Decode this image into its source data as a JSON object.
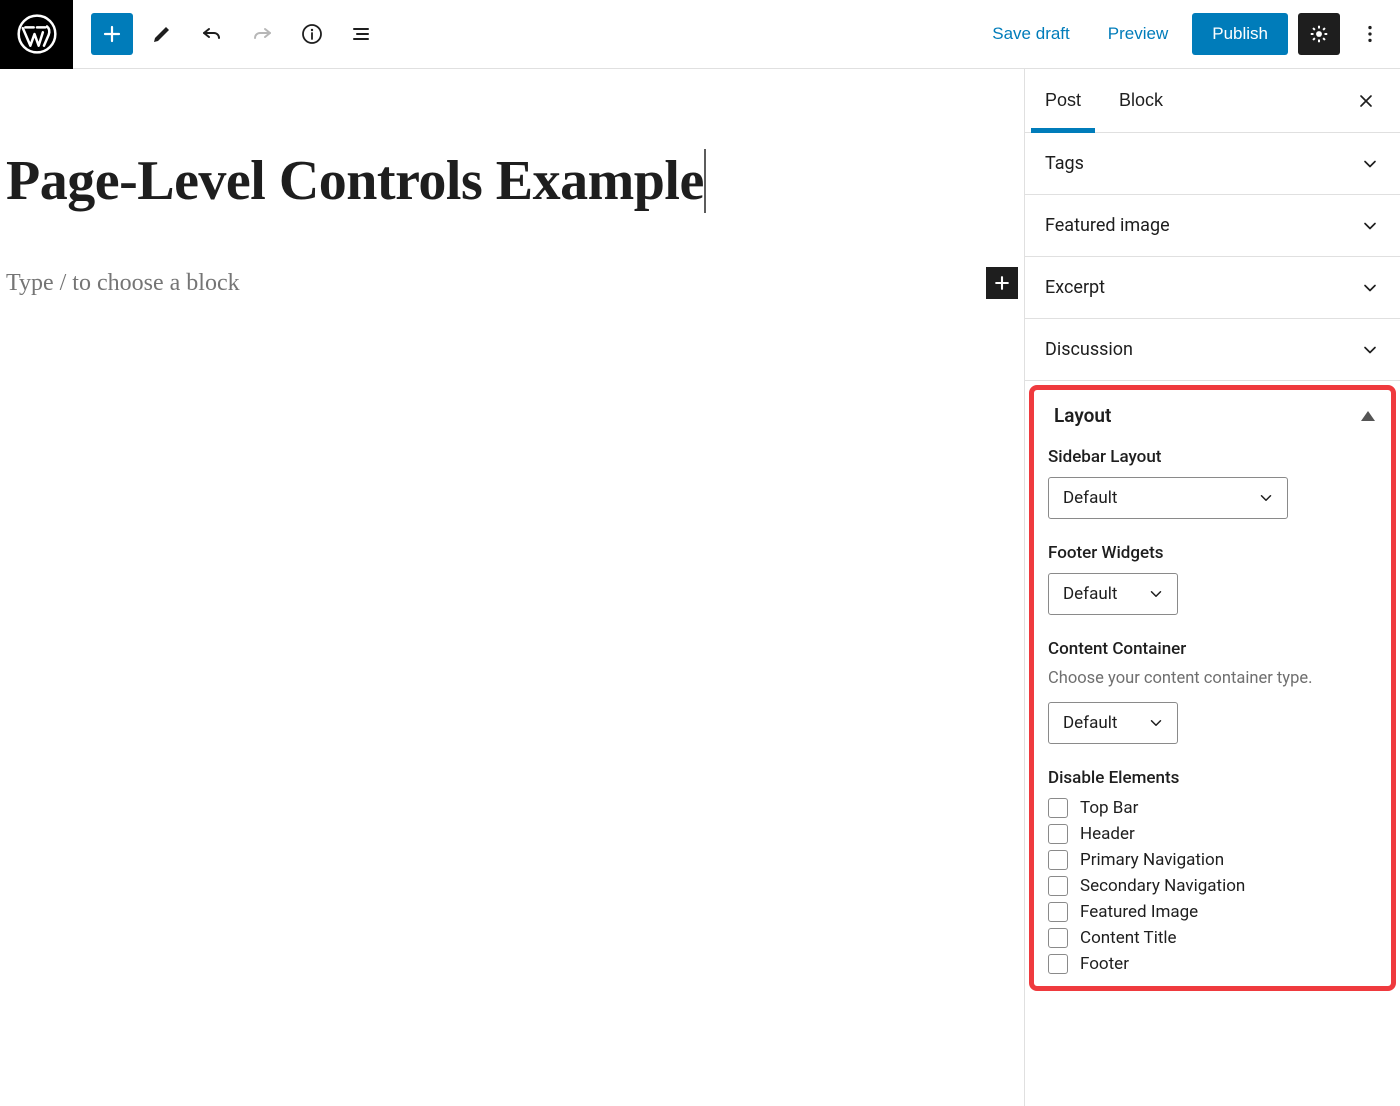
{
  "colors": {
    "accent": "#007cba",
    "highlight_border": "#ef3a3e"
  },
  "header": {
    "save_draft": "Save draft",
    "preview": "Preview",
    "publish": "Publish"
  },
  "editor": {
    "title": "Page-Level Controls Example",
    "placeholder": "Type / to choose a block"
  },
  "sidebar": {
    "tabs": {
      "post": "Post",
      "block": "Block",
      "active": "Post"
    },
    "panels": {
      "tags": "Tags",
      "featured_image": "Featured image",
      "excerpt": "Excerpt",
      "discussion": "Discussion"
    },
    "layout": {
      "title": "Layout",
      "sidebar_layout": {
        "label": "Sidebar Layout",
        "value": "Default"
      },
      "footer_widgets": {
        "label": "Footer Widgets",
        "value": "Default"
      },
      "content_container": {
        "label": "Content Container",
        "help": "Choose your content container type.",
        "value": "Default"
      },
      "disable_elements": {
        "label": "Disable Elements",
        "items": [
          {
            "label": "Top Bar",
            "checked": false
          },
          {
            "label": "Header",
            "checked": false
          },
          {
            "label": "Primary Navigation",
            "checked": false
          },
          {
            "label": "Secondary Navigation",
            "checked": false
          },
          {
            "label": "Featured Image",
            "checked": false
          },
          {
            "label": "Content Title",
            "checked": false
          },
          {
            "label": "Footer",
            "checked": false
          }
        ]
      }
    }
  }
}
